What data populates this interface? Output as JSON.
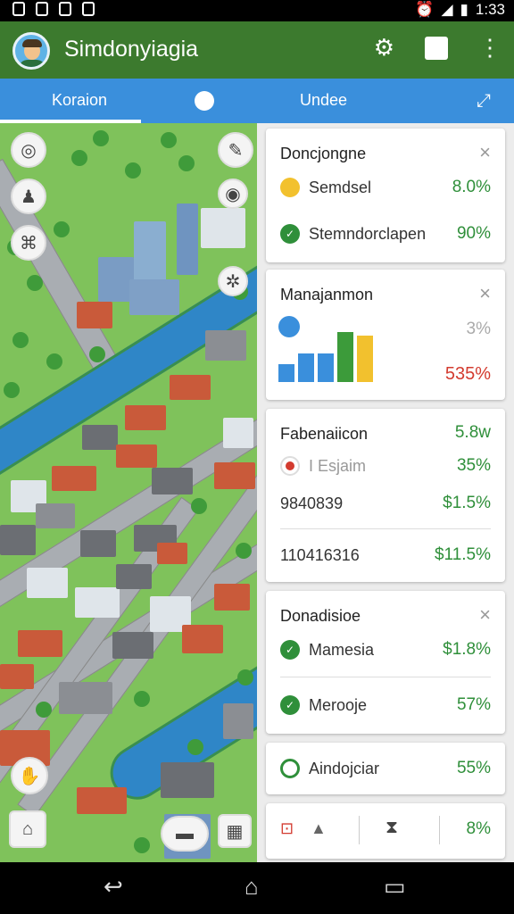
{
  "status": {
    "time": "1:33"
  },
  "app": {
    "title": "Simdonyiagia"
  },
  "tabs": [
    {
      "label": "Koraion"
    },
    {
      "label": "Undee"
    }
  ],
  "cards": {
    "c1": {
      "title": "Doncjongne",
      "rows": [
        {
          "label": "Semdsel",
          "value": "8.0%",
          "color": "#f2c12e"
        },
        {
          "label": "Stemndorclapen",
          "value": "90%",
          "color": "#2f8f3a"
        }
      ]
    },
    "c2": {
      "title": "Manajanmon",
      "small": "3%",
      "big": "535%"
    },
    "c3": {
      "title": "Fabenaiicon",
      "top_value": "5.8w",
      "rows": [
        {
          "label": "I Esjaim",
          "value": "35%"
        },
        {
          "label": "9840839",
          "value": "$1.5%"
        },
        {
          "label": "110416316",
          "value": "$11.5%"
        }
      ]
    },
    "c4": {
      "title": "Donadisioe",
      "rows": [
        {
          "label": "Mamesia",
          "value": "$1.8%"
        },
        {
          "label": "Merooje",
          "value": "57%"
        }
      ]
    },
    "c5": {
      "label": "Aindojciar",
      "value": "55%"
    },
    "c6": {
      "value": "8%"
    }
  },
  "colors": {
    "appbar": "#3c7a2e",
    "tabbar": "#3a8fdc",
    "green_value": "#2f8f3a",
    "red_value": "#d33b2f"
  }
}
